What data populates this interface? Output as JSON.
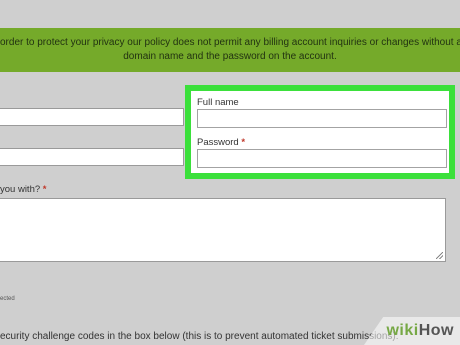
{
  "banner": {
    "line1": "order to protect your privacy our policy does not permit any billing account inquiries or changes without a",
    "line2": "domain name and the password on the account."
  },
  "form": {
    "full_name_label": "Full name",
    "password_label": "Password",
    "required_marker": "*",
    "question_label": "you with?",
    "small_note": "ected",
    "challenge_text": "ecurity challenge codes in the box below (this is to prevent automated ticket submissions):"
  },
  "watermark": {
    "wiki": "wiki",
    "how": "How"
  },
  "colors": {
    "banner": "#75aa2a",
    "highlight": "#3be03b",
    "required": "#c0392b"
  }
}
